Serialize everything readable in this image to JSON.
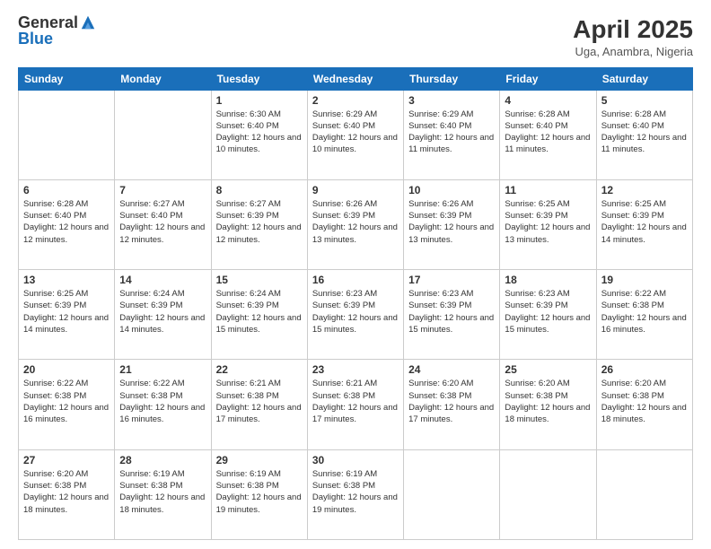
{
  "logo": {
    "general": "General",
    "blue": "Blue"
  },
  "title": {
    "main": "April 2025",
    "sub": "Uga, Anambra, Nigeria"
  },
  "headers": [
    "Sunday",
    "Monday",
    "Tuesday",
    "Wednesday",
    "Thursday",
    "Friday",
    "Saturday"
  ],
  "weeks": [
    [
      {
        "day": "",
        "info": ""
      },
      {
        "day": "",
        "info": ""
      },
      {
        "day": "1",
        "info": "Sunrise: 6:30 AM\nSunset: 6:40 PM\nDaylight: 12 hours and 10 minutes."
      },
      {
        "day": "2",
        "info": "Sunrise: 6:29 AM\nSunset: 6:40 PM\nDaylight: 12 hours and 10 minutes."
      },
      {
        "day": "3",
        "info": "Sunrise: 6:29 AM\nSunset: 6:40 PM\nDaylight: 12 hours and 11 minutes."
      },
      {
        "day": "4",
        "info": "Sunrise: 6:28 AM\nSunset: 6:40 PM\nDaylight: 12 hours and 11 minutes."
      },
      {
        "day": "5",
        "info": "Sunrise: 6:28 AM\nSunset: 6:40 PM\nDaylight: 12 hours and 11 minutes."
      }
    ],
    [
      {
        "day": "6",
        "info": "Sunrise: 6:28 AM\nSunset: 6:40 PM\nDaylight: 12 hours and 12 minutes."
      },
      {
        "day": "7",
        "info": "Sunrise: 6:27 AM\nSunset: 6:40 PM\nDaylight: 12 hours and 12 minutes."
      },
      {
        "day": "8",
        "info": "Sunrise: 6:27 AM\nSunset: 6:39 PM\nDaylight: 12 hours and 12 minutes."
      },
      {
        "day": "9",
        "info": "Sunrise: 6:26 AM\nSunset: 6:39 PM\nDaylight: 12 hours and 13 minutes."
      },
      {
        "day": "10",
        "info": "Sunrise: 6:26 AM\nSunset: 6:39 PM\nDaylight: 12 hours and 13 minutes."
      },
      {
        "day": "11",
        "info": "Sunrise: 6:25 AM\nSunset: 6:39 PM\nDaylight: 12 hours and 13 minutes."
      },
      {
        "day": "12",
        "info": "Sunrise: 6:25 AM\nSunset: 6:39 PM\nDaylight: 12 hours and 14 minutes."
      }
    ],
    [
      {
        "day": "13",
        "info": "Sunrise: 6:25 AM\nSunset: 6:39 PM\nDaylight: 12 hours and 14 minutes."
      },
      {
        "day": "14",
        "info": "Sunrise: 6:24 AM\nSunset: 6:39 PM\nDaylight: 12 hours and 14 minutes."
      },
      {
        "day": "15",
        "info": "Sunrise: 6:24 AM\nSunset: 6:39 PM\nDaylight: 12 hours and 15 minutes."
      },
      {
        "day": "16",
        "info": "Sunrise: 6:23 AM\nSunset: 6:39 PM\nDaylight: 12 hours and 15 minutes."
      },
      {
        "day": "17",
        "info": "Sunrise: 6:23 AM\nSunset: 6:39 PM\nDaylight: 12 hours and 15 minutes."
      },
      {
        "day": "18",
        "info": "Sunrise: 6:23 AM\nSunset: 6:39 PM\nDaylight: 12 hours and 15 minutes."
      },
      {
        "day": "19",
        "info": "Sunrise: 6:22 AM\nSunset: 6:38 PM\nDaylight: 12 hours and 16 minutes."
      }
    ],
    [
      {
        "day": "20",
        "info": "Sunrise: 6:22 AM\nSunset: 6:38 PM\nDaylight: 12 hours and 16 minutes."
      },
      {
        "day": "21",
        "info": "Sunrise: 6:22 AM\nSunset: 6:38 PM\nDaylight: 12 hours and 16 minutes."
      },
      {
        "day": "22",
        "info": "Sunrise: 6:21 AM\nSunset: 6:38 PM\nDaylight: 12 hours and 17 minutes."
      },
      {
        "day": "23",
        "info": "Sunrise: 6:21 AM\nSunset: 6:38 PM\nDaylight: 12 hours and 17 minutes."
      },
      {
        "day": "24",
        "info": "Sunrise: 6:20 AM\nSunset: 6:38 PM\nDaylight: 12 hours and 17 minutes."
      },
      {
        "day": "25",
        "info": "Sunrise: 6:20 AM\nSunset: 6:38 PM\nDaylight: 12 hours and 18 minutes."
      },
      {
        "day": "26",
        "info": "Sunrise: 6:20 AM\nSunset: 6:38 PM\nDaylight: 12 hours and 18 minutes."
      }
    ],
    [
      {
        "day": "27",
        "info": "Sunrise: 6:20 AM\nSunset: 6:38 PM\nDaylight: 12 hours and 18 minutes."
      },
      {
        "day": "28",
        "info": "Sunrise: 6:19 AM\nSunset: 6:38 PM\nDaylight: 12 hours and 18 minutes."
      },
      {
        "day": "29",
        "info": "Sunrise: 6:19 AM\nSunset: 6:38 PM\nDaylight: 12 hours and 19 minutes."
      },
      {
        "day": "30",
        "info": "Sunrise: 6:19 AM\nSunset: 6:38 PM\nDaylight: 12 hours and 19 minutes."
      },
      {
        "day": "",
        "info": ""
      },
      {
        "day": "",
        "info": ""
      },
      {
        "day": "",
        "info": ""
      }
    ]
  ]
}
